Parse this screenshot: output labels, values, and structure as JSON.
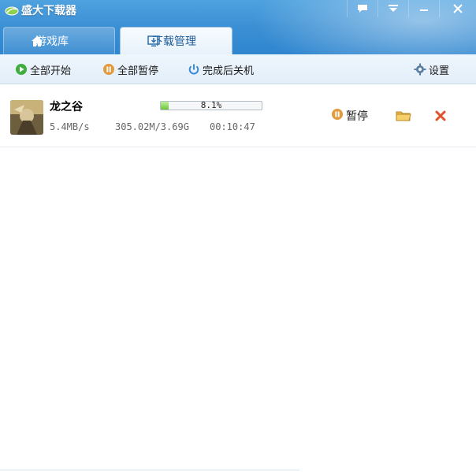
{
  "app": {
    "title": "盛大下载器",
    "logo_icon": "shanda-leaf-logo"
  },
  "window_controls": {
    "message_icon": "message-icon",
    "menu_icon": "dropdown-menu-icon",
    "minimize_icon": "minimize-icon",
    "close_icon": "close-icon"
  },
  "tabs": [
    {
      "label": "游戏库",
      "icon": "home-icon",
      "active": false
    },
    {
      "label": "下载管理",
      "icon": "monitor-download-icon",
      "active": true
    }
  ],
  "toolbar": {
    "start_all": "全部开始",
    "pause_all": "全部暂停",
    "shutdown_after": "完成后关机",
    "settings": "设置"
  },
  "downloads": [
    {
      "name": "龙之谷",
      "progress_text": "8.1%",
      "progress": 0.081,
      "speed": "5.4MB/s",
      "size": "305.02M/3.69G",
      "remaining": "00:10:47",
      "pause_label": "暂停"
    }
  ],
  "colors": {
    "titlebar": "#3b8fd4",
    "progress_fill": "#6cc63c",
    "start_green": "#3fae3f",
    "pause_orange": "#e39a3c",
    "power_blue": "#3a8cd6",
    "delete_red": "#e0522a"
  }
}
